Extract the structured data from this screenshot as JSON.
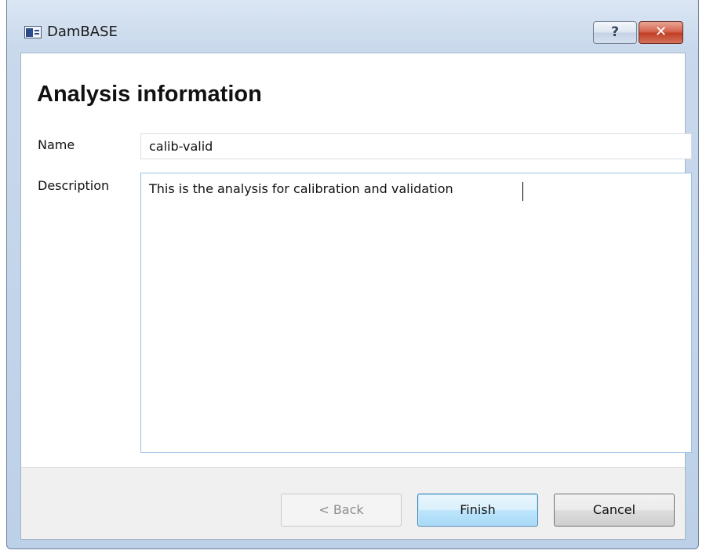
{
  "window": {
    "title": "DamBASE",
    "help_label": "?",
    "close_label": "✕"
  },
  "page": {
    "title": "Analysis information"
  },
  "form": {
    "name_label": "Name",
    "name_value": "calib-valid",
    "description_label": "Description",
    "description_value": "This is the analysis for calibration and validation"
  },
  "buttons": {
    "back": "< Back",
    "finish": "Finish",
    "cancel": "Cancel"
  },
  "icons": {
    "app": "app-window-icon",
    "help": "question-mark-icon",
    "close": "close-x-icon"
  },
  "colors": {
    "accent": "#3c7fb1",
    "close": "#c13d23"
  }
}
